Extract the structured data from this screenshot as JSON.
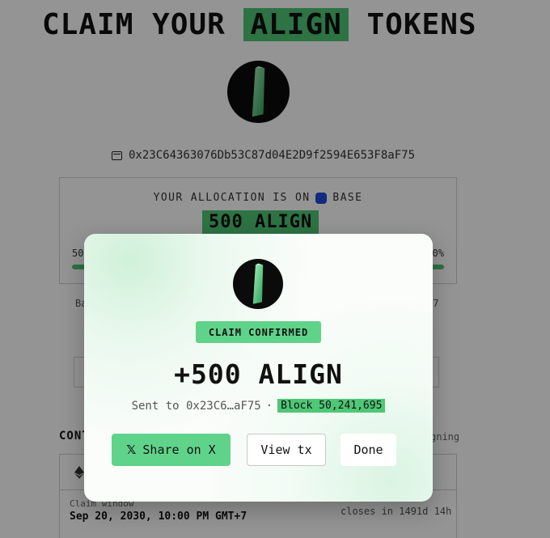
{
  "page": {
    "title_prefix": "CLAIM YOUR",
    "title_highlight": "ALIGN",
    "title_suffix": "TOKENS",
    "wallet_address": "0x23C64363076Db53C87d04E2D9f2594E653F8aF75"
  },
  "allocation": {
    "label_prefix": "YOUR ALLOCATION IS ON",
    "network": "BASE",
    "amount": "500 ALIGN",
    "progress_left_partial": "50",
    "progress_right_partial": "0%",
    "progress_fill_percent": 100,
    "stub_left": "Ba",
    "stub_right": "+7"
  },
  "contract": {
    "heading_partial": "CONT",
    "signing_partial": "gning",
    "claim_window_label": "Claim window",
    "claim_window_date": "Sep 20, 2030, 10:00 PM GMT+7",
    "closes_in": "closes in 1491d 14h"
  },
  "modal": {
    "badge": "CLAIM CONFIRMED",
    "amount": "+500 ALIGN",
    "sent_to": "Sent to 0x23C6…aF75",
    "separator": "·",
    "block": "Block 50,241,695",
    "share_label": "Share on X",
    "share_icon": "𝕏",
    "view_tx_label": "View tx",
    "done_label": "Done"
  },
  "colors": {
    "accent_green": "#4ec776",
    "badge_green": "#5fd38a",
    "base_blue": "#1f4bdb"
  },
  "icons": [
    "align-logo-icon",
    "wallet-icon",
    "base-network-icon",
    "ethereum-icon",
    "x-logo-icon"
  ]
}
